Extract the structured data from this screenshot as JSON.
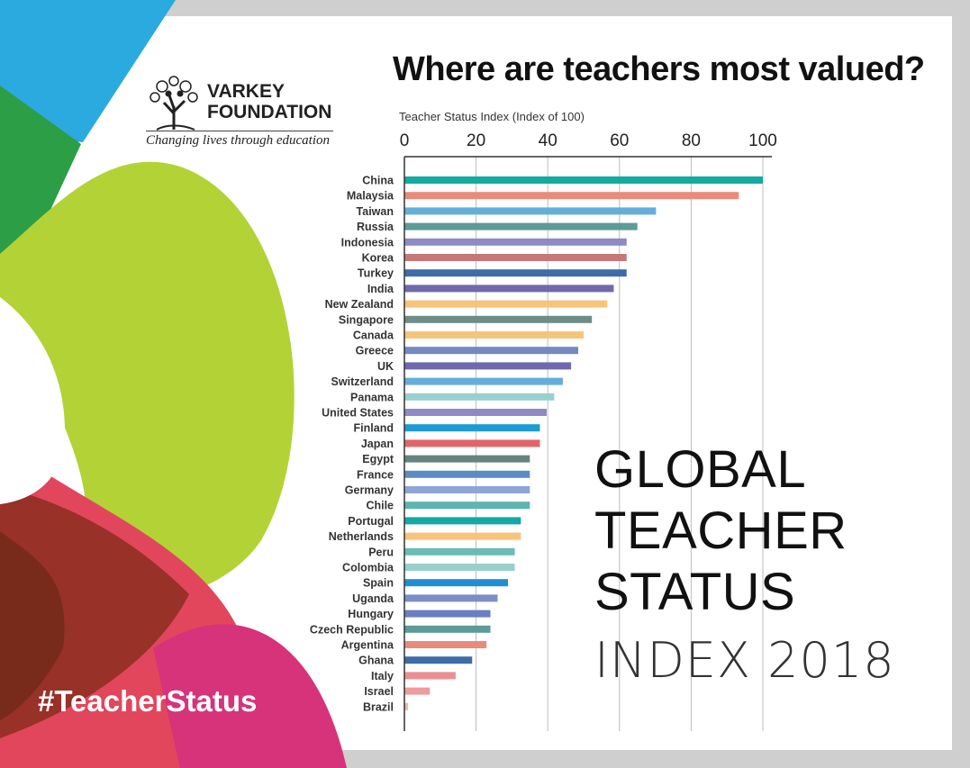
{
  "logo": {
    "name_line1": "VARKEY",
    "name_line2": "FOUNDATION",
    "tagline": "Changing lives through education",
    "icon": "tree-logo-icon"
  },
  "hashtag": "#TeacherStatus",
  "headline": {
    "line1": "GLOBAL",
    "line2": "TEACHER",
    "line3": "STATUS",
    "line4": "INDEX 2018"
  },
  "chart_data": {
    "type": "bar",
    "orientation": "horizontal",
    "title": "Where are teachers most valued?",
    "xlabel": "Teacher Status Index (Index of 100)",
    "ylabel": "",
    "xlim": [
      0,
      100
    ],
    "xticks": [
      0,
      20,
      40,
      60,
      80,
      100
    ],
    "grid": true,
    "categories": [
      "China",
      "Malaysia",
      "Taiwan",
      "Russia",
      "Indonesia",
      "Korea",
      "Turkey",
      "India",
      "New Zealand",
      "Singapore",
      "Canada",
      "Greece",
      "UK",
      "Switzerland",
      "Panama",
      "United States",
      "Finland",
      "Japan",
      "Egypt",
      "France",
      "Germany",
      "Chile",
      "Portugal",
      "Netherlands",
      "Peru",
      "Colombia",
      "Spain",
      "Uganda",
      "Hungary",
      "Czech Republic",
      "Argentina",
      "Ghana",
      "Italy",
      "Israel",
      "Brazil"
    ],
    "values": [
      100,
      93.3,
      70.2,
      65.0,
      62.0,
      62.0,
      62.0,
      58.4,
      56.6,
      52.3,
      50.0,
      48.5,
      46.5,
      44.2,
      41.8,
      39.7,
      37.8,
      37.8,
      35.0,
      35.0,
      35.0,
      35.0,
      32.5,
      32.5,
      30.8,
      30.8,
      28.9,
      26.0,
      24.0,
      24.0,
      22.9,
      18.9,
      14.3,
      7.1,
      1.0
    ],
    "colors": [
      "#12aaa2",
      "#e98b7b",
      "#65aedb",
      "#5b9b98",
      "#8e8ac4",
      "#c57878",
      "#3f6ca8",
      "#6f69ad",
      "#f7c47a",
      "#6e8c88",
      "#f7c47a",
      "#7488c2",
      "#6f69ad",
      "#65aedb",
      "#97d0cf",
      "#8e8ac4",
      "#1c9bd6",
      "#e36468",
      "#668382",
      "#5b8bc5",
      "#8ea6d6",
      "#5bb5b0",
      "#12aaa2",
      "#f7c47a",
      "#6bbcb5",
      "#97d0cf",
      "#1f8fd0",
      "#7b8fc6",
      "#6b7fc0",
      "#5b9b98",
      "#e98b7b",
      "#3f6ca8",
      "#ec8f92",
      "#ee9c9c",
      "#f2b2b2"
    ]
  }
}
